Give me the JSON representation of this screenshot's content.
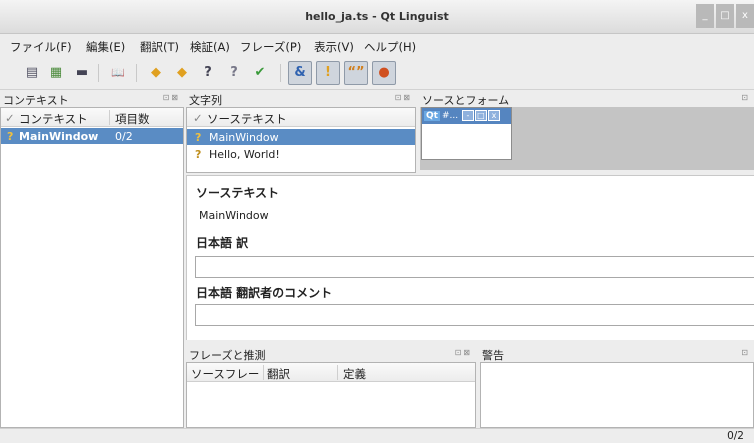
{
  "window": {
    "title": "hello_ja.ts - Qt Linguist",
    "controls": [
      "_",
      "□",
      "x"
    ]
  },
  "menu": [
    "ファイル(F)",
    "編集(E)",
    "翻訳(T)",
    "検証(A)",
    "フレーズ(P)",
    "表示(V)",
    "ヘルプ(H)"
  ],
  "toolbar": {
    "buttons": [
      {
        "name": "open-icon",
        "glyph": "▤"
      },
      {
        "name": "save-icon",
        "glyph": "▦"
      },
      {
        "name": "print-icon",
        "glyph": "▬"
      },
      {
        "name": "phrasebook-icon",
        "glyph": "📖"
      },
      {
        "name": "prev-icon",
        "glyph": "◆"
      },
      {
        "name": "next-icon",
        "glyph": "◆"
      },
      {
        "name": "prev-unfinished-icon",
        "glyph": "?"
      },
      {
        "name": "next-unfinished-icon",
        "glyph": "?"
      },
      {
        "name": "done-next-icon",
        "glyph": "✔"
      },
      {
        "name": "accelerator-check-icon",
        "glyph": "&"
      },
      {
        "name": "punctuation-check-icon",
        "glyph": "!"
      },
      {
        "name": "phrase-check-icon",
        "glyph": "“”"
      },
      {
        "name": "placemarker-check-icon",
        "glyph": "●"
      }
    ]
  },
  "context_dock": {
    "title": "コンテキスト",
    "columns": [
      "コンテキスト",
      "項目数"
    ],
    "rows": [
      {
        "status": "?",
        "name": "MainWindow",
        "count": "0/2"
      }
    ]
  },
  "strings_dock": {
    "title": "文字列",
    "column": "ソーステキスト",
    "rows": [
      {
        "status": "?",
        "text": "MainWindow"
      },
      {
        "status": "?",
        "text": "Hello, World!"
      }
    ]
  },
  "sources_dock": {
    "title": "ソースとフォーム",
    "preview_title": "#..."
  },
  "editor": {
    "source_label": "ソーステキスト",
    "source_text": "MainWindow",
    "translation_label": "日本語 訳",
    "translation_value": "",
    "comment_label": "日本語 翻訳者のコメント",
    "comment_value": ""
  },
  "phrases_dock": {
    "title": "フレーズと推測",
    "columns": [
      "ソースフレー",
      "翻訳",
      "定義"
    ]
  },
  "warnings_dock": {
    "title": "警告"
  },
  "status": {
    "progress": "0/2"
  }
}
